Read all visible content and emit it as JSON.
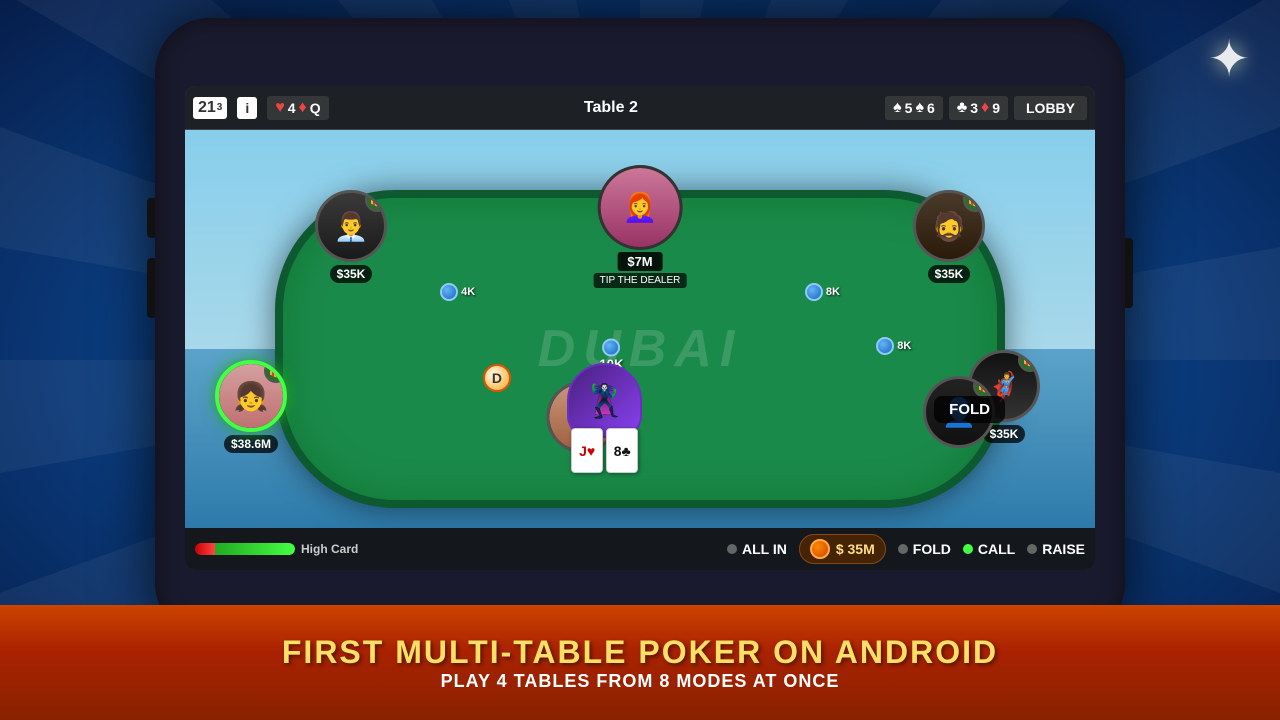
{
  "background": {
    "color_start": "#1a6bc4",
    "color_end": "#061d4a"
  },
  "phone": {
    "screen": {
      "top_bar": {
        "tab_badge": "21",
        "tab_badge_sub": "3",
        "info_btn": "i",
        "hand1": {
          "suit1": "♥",
          "val1": "4",
          "suit2": "♦",
          "val2": "Q"
        },
        "table_name": "Table 2",
        "hand2": {
          "suit1": "♠",
          "val1": "5",
          "suit2": "♠",
          "val2": "6"
        },
        "hand3": {
          "suit1": "♣",
          "val1": "3",
          "suit2": "♦",
          "val2": "9"
        },
        "lobby_btn": "LOBBY"
      },
      "game": {
        "dubai_label": "DUBAI",
        "players": [
          {
            "id": "top-left",
            "balance": "$35K",
            "chips": "4K",
            "has_gift": true
          },
          {
            "id": "top-center-dealer",
            "balance": "$7M",
            "label": "TIP THE DEALER",
            "chips": ""
          },
          {
            "id": "top-right",
            "balance": "$35K",
            "chips": "8K",
            "has_gift": true
          },
          {
            "id": "middle-right",
            "balance": "$35K",
            "chips": "8K",
            "has_gift": true
          },
          {
            "id": "bottom-right",
            "balance": "",
            "chips": "",
            "has_gift": false
          },
          {
            "id": "bottom-center",
            "balance": "",
            "chips": "",
            "has_gift": false
          },
          {
            "id": "left",
            "balance": "$38.6M",
            "chips": "",
            "has_gift": true,
            "is_active": true
          }
        ],
        "center_pot": "10K",
        "dealer_badge": "D",
        "fold_popup": "FOLD",
        "hand_cards": [
          "J♥",
          "8♣"
        ]
      },
      "action_bar": {
        "hand_strength": "High Card",
        "all_in_label": "ALL IN",
        "pot_amount": "$ 35M",
        "fold_label": "FOLD",
        "call_label": "CALL",
        "raise_label": "RAISE"
      }
    }
  },
  "bottom_banner": {
    "main_text": "FIRST MULTI-TABLE POKER ON ANDROID",
    "sub_text": "PLAY 4 TABLES FROM 8 MODES AT ONCE"
  },
  "sparkle": "✦"
}
